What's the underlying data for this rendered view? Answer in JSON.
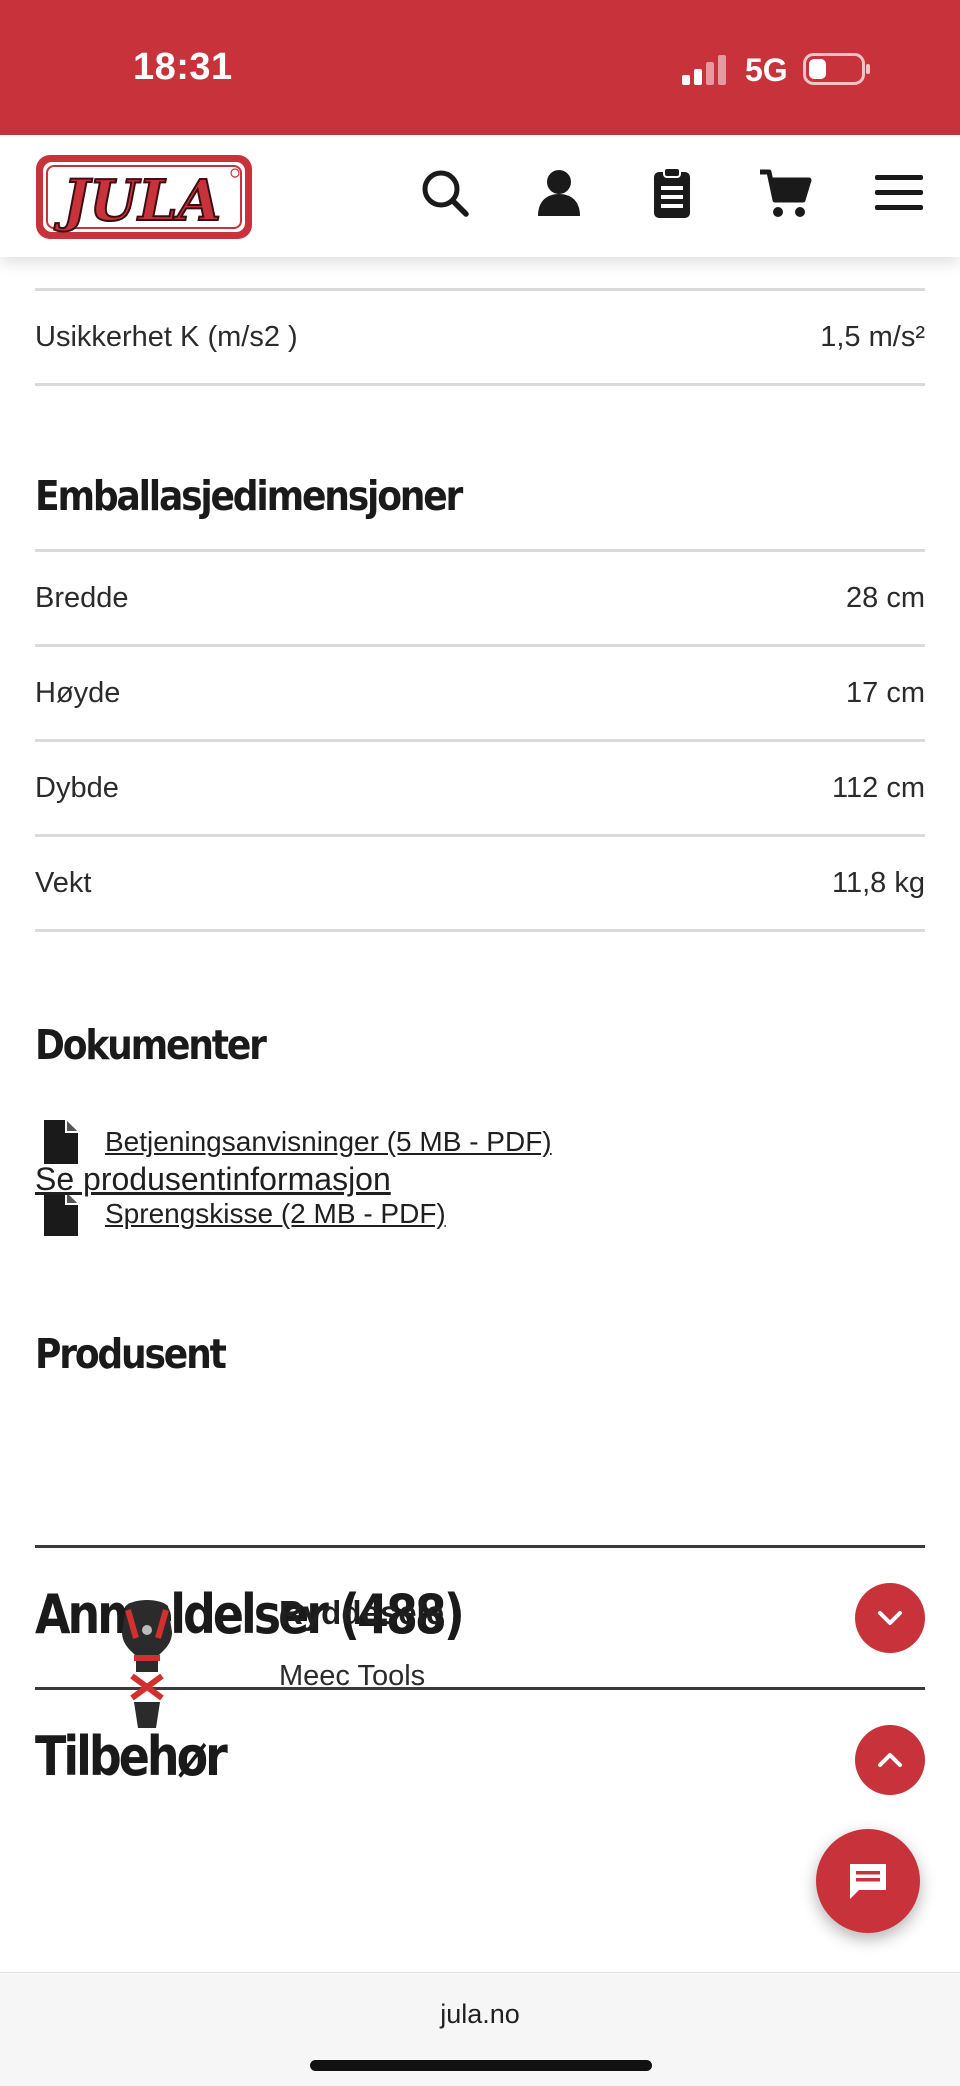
{
  "status_bar": {
    "time": "18:31",
    "network": "5G"
  },
  "header": {
    "logo_text": "JULA",
    "icons": [
      "search-icon",
      "account-icon",
      "clipboard-icon",
      "cart-icon",
      "menu-icon"
    ]
  },
  "specs_tail": {
    "label": "Usikkerhet K (m/s2 )",
    "value": "1,5 m/s²"
  },
  "packaging": {
    "title": "Emballasjedimensjoner",
    "rows": [
      {
        "label": "Bredde",
        "value": "28 cm"
      },
      {
        "label": "Høyde",
        "value": "17 cm"
      },
      {
        "label": "Dybde",
        "value": "112 cm"
      },
      {
        "label": "Vekt",
        "value": "11,8 kg"
      }
    ]
  },
  "documents": {
    "title": "Dokumenter",
    "items": [
      {
        "label": "Betjeningsanvisninger (5 MB - PDF)"
      },
      {
        "label": "Sprengskisse (2 MB - PDF)"
      }
    ]
  },
  "manufacturer": {
    "title": "Produsent",
    "link": "Se produsentinformasjon"
  },
  "reviews": {
    "title": "Anmeldelser (488)"
  },
  "accessories": {
    "title": "Tilbehør",
    "product": {
      "name": "Ryddesele",
      "brand": "Meec Tools"
    }
  },
  "browser": {
    "url": "jula.no"
  },
  "colors": {
    "brand_red": "#c8333b",
    "divider": "#dadada"
  }
}
